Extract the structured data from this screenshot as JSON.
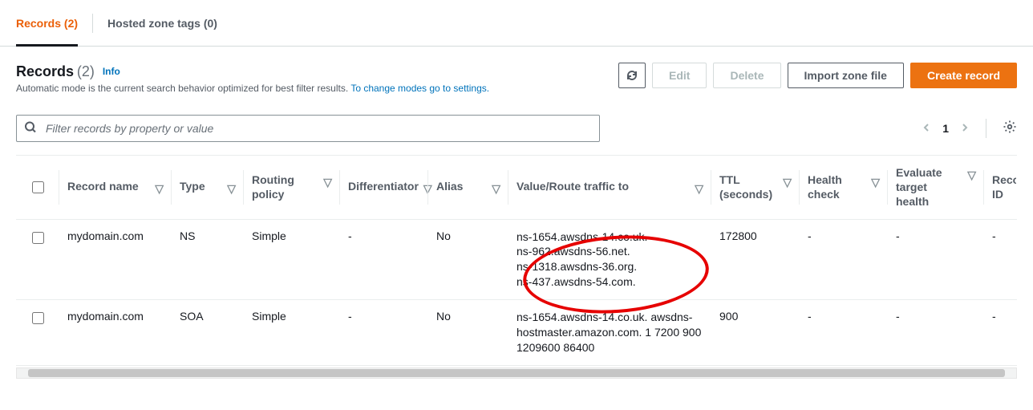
{
  "tabs": {
    "records": "Records (2)",
    "hosted_zone_tags": "Hosted zone tags (0)"
  },
  "header": {
    "title": "Records",
    "count": "(2)",
    "info": "Info",
    "desc_text": "Automatic mode is the current search behavior optimized for best filter results. ",
    "desc_link": "To change modes go to settings."
  },
  "actions": {
    "edit": "Edit",
    "delete": "Delete",
    "import": "Import zone file",
    "create": "Create record"
  },
  "filter": {
    "placeholder": "Filter records by property or value"
  },
  "pager": {
    "page": "1"
  },
  "columns": {
    "record_name": "Record name",
    "type": "Type",
    "routing_policy": "Routing policy",
    "differentiator": "Differentiator",
    "alias": "Alias",
    "value_route": "Value/Route traffic to",
    "ttl": "TTL (seconds)",
    "health_check": "Health check",
    "evaluate_target_health": "Evaluate target health",
    "record_id": "Record ID"
  },
  "rows": [
    {
      "record_name": "mydomain.com",
      "type": "NS",
      "routing_policy": "Simple",
      "differentiator": "-",
      "alias": "No",
      "value_route": "ns-1654.awsdns-14.co.uk.\nns-962.awsdns-56.net.\nns-1318.awsdns-36.org.\nns-437.awsdns-54.com.",
      "ttl": "172800",
      "health_check": "-",
      "evaluate_target_health": "-",
      "record_id": "-"
    },
    {
      "record_name": "mydomain.com",
      "type": "SOA",
      "routing_policy": "Simple",
      "differentiator": "-",
      "alias": "No",
      "value_route": "ns-1654.awsdns-14.co.uk. awsdns-hostmaster.amazon.com. 1 7200 900 1209600 86400",
      "ttl": "900",
      "health_check": "-",
      "evaluate_target_health": "-",
      "record_id": "-"
    }
  ]
}
